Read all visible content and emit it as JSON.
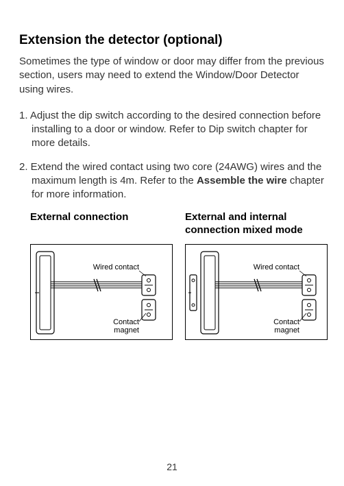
{
  "title": "Extension the detector (optional)",
  "intro": "Sometimes the type of window or door may differ from the previous section, users may need to extend the Window/Door Detector using wires.",
  "step1": "1. Adjust the dip switch according to the desired connection before installing to a door or window. Refer to Dip switch chapter for more details.",
  "step2_prefix": "2. Extend the wired contact using two core (24AWG) wires and the maximum length is 4m. Refer to the ",
  "step2_bold": "Assemble the wire",
  "step2_suffix": " chapter for more information.",
  "diagrams": {
    "left": {
      "heading": "External connection",
      "label_wired": "Wired contact",
      "label_magnet1": "Contact",
      "label_magnet2": "magnet"
    },
    "right": {
      "heading": "External and internal connection mixed mode",
      "label_wired": "Wired contact",
      "label_magnet1": "Contact",
      "label_magnet2": "magnet"
    }
  },
  "page_number": "21"
}
